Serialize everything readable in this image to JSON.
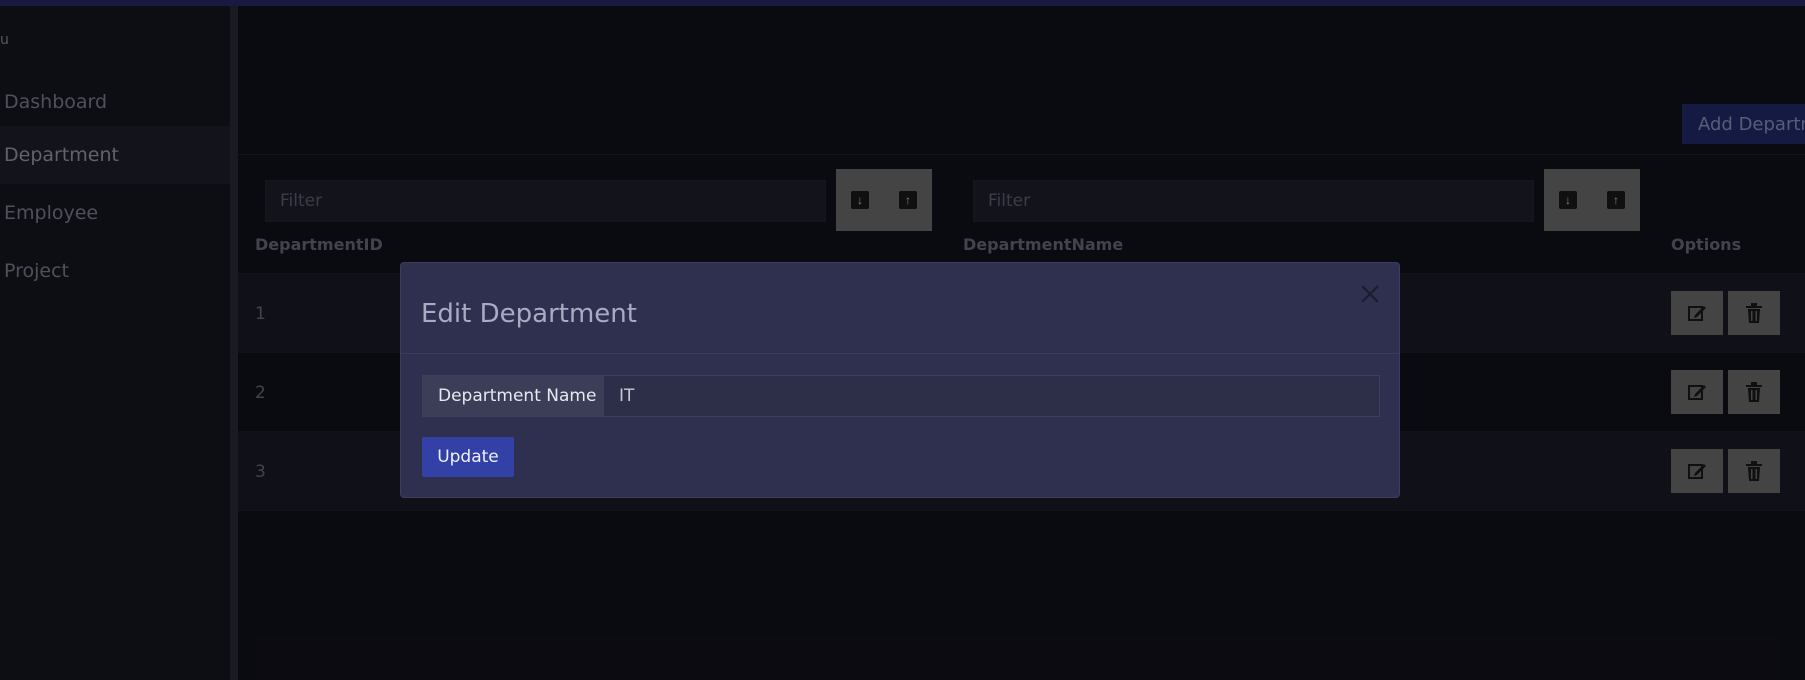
{
  "sidebar": {
    "brand": "u",
    "items": [
      {
        "label": "Dashboard"
      },
      {
        "label": "Department"
      },
      {
        "label": "Employee"
      },
      {
        "label": "Project"
      }
    ]
  },
  "main": {
    "add_button_label": "Add Department",
    "filters": [
      {
        "placeholder": "Filter"
      },
      {
        "placeholder": "Filter"
      }
    ],
    "columns": [
      "DepartmentID",
      "DepartmentName",
      "Options"
    ],
    "rows": [
      {
        "id": "1"
      },
      {
        "id": "2"
      },
      {
        "id": "3"
      }
    ]
  },
  "modal": {
    "title": "Edit Department",
    "field_label": "Department Name",
    "field_value": "IT",
    "update_label": "Update"
  },
  "colors": {
    "accent": "#3340a6",
    "background": "#11121b",
    "modal": "#2f3050"
  }
}
